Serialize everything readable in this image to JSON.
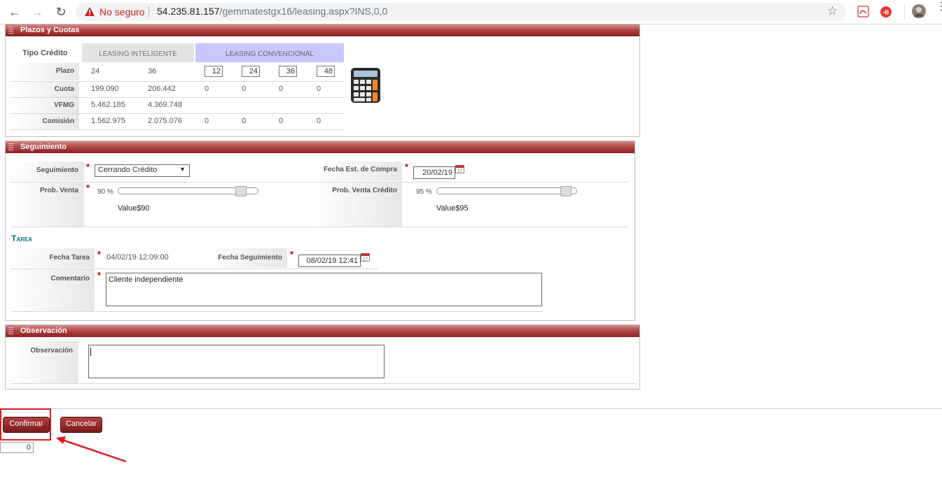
{
  "browser": {
    "security_label": "No seguro",
    "url_host": "54.235.81.157",
    "url_path": "/gemmatestgx16/leasing.aspx?INS,0,0"
  },
  "plazos": {
    "title": "Plazos y Cuotas",
    "tipo_credito_label": "Tipo Crédito",
    "inteligente_header": "LEASING INTELIGENTE",
    "convencional_header": "LEASING CONVENCIONAL",
    "row_labels": {
      "plazo": "Plazo",
      "cuota": "Cuota",
      "vfmg": "VFMG",
      "comision": "Comisión"
    },
    "inteligente": {
      "plazo": [
        "24",
        "36"
      ],
      "cuota": [
        "199.090",
        "206.442"
      ],
      "vfmg": [
        "5.462.185",
        "4.369.748"
      ],
      "comision": [
        "1.562.975",
        "2.075.076"
      ]
    },
    "convencional": {
      "plazo": [
        "12",
        "24",
        "36",
        "48"
      ],
      "cuota": [
        "0",
        "0",
        "0",
        "0"
      ],
      "comision": [
        "0",
        "0",
        "0",
        "0"
      ]
    }
  },
  "seguimiento": {
    "title": "Seguimiento",
    "seguimiento_label": "Seguimiento",
    "seguimiento_value": "Cerrando Crédito",
    "fecha_compra_label": "Fecha Est. de Compra",
    "fecha_compra_value": "20/02/19",
    "prob_venta_label": "Prob. Venta",
    "prob_venta_pct": "90 %",
    "prob_venta_level": 0.9,
    "prob_venta_value": "Value$90",
    "prob_venta_credito_label": "Prob. Venta Crédito",
    "prob_venta_credito_pct": "95 %",
    "prob_venta_credito_level": 0.95,
    "prob_venta_credito_value": "Value$95",
    "tarea_heading": "Tarea",
    "fecha_tarea_label": "Fecha Tarea",
    "fecha_tarea_value": "04/02/19 12:09:00",
    "fecha_seguimiento_label": "Fecha Seguimiento",
    "fecha_seguimiento_value": "08/02/19 12:41",
    "comentario_label": "Comentario",
    "comentario_value": "Cliente independiente"
  },
  "observacion": {
    "title": "Observación",
    "label": "Observación",
    "value": ""
  },
  "actions": {
    "confirm_label": "Confirmar",
    "cancel_label": "Cancelar",
    "counter_value": "0"
  },
  "colors": {
    "header_red": "#8e2020",
    "highlight_red": "#e0191f",
    "convencional_bg": "#c8c8ff",
    "tarea_teal": "#1a6a7a"
  }
}
